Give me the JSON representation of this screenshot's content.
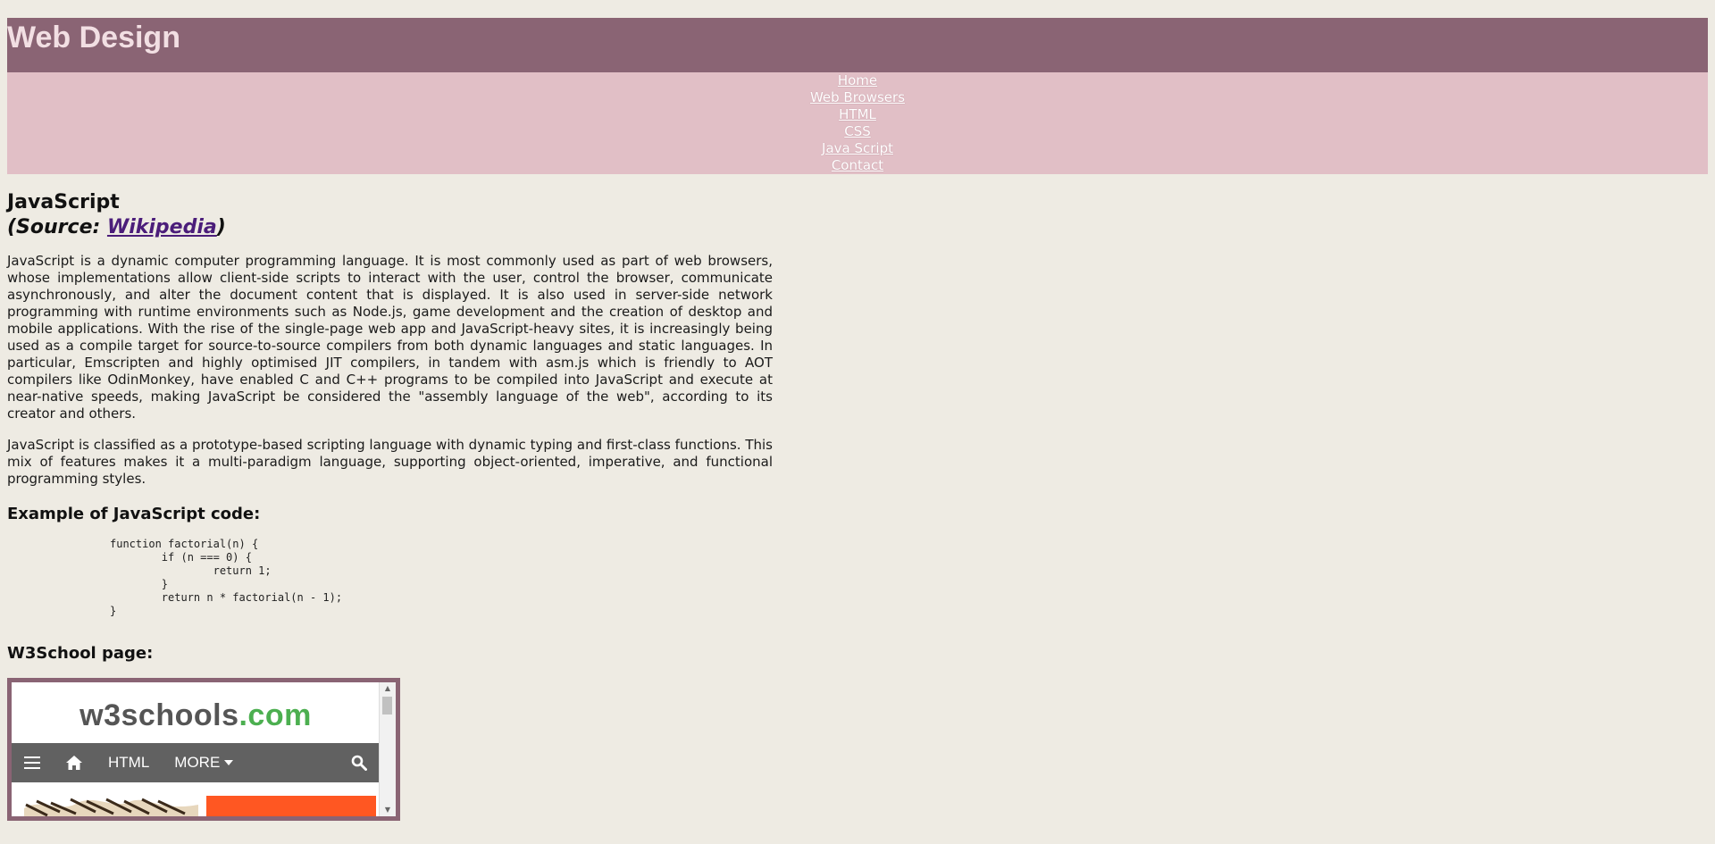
{
  "header": {
    "title": "Web Design"
  },
  "nav": {
    "items": [
      {
        "label": "Home"
      },
      {
        "label": "Web Browsers"
      },
      {
        "label": "HTML"
      },
      {
        "label": "CSS"
      },
      {
        "label": "Java Script"
      },
      {
        "label": "Contact"
      }
    ]
  },
  "main": {
    "title": "JavaScript",
    "source_prefix": "(Source: ",
    "source_link": "Wikipedia",
    "source_suffix": ")",
    "paragraph_1": "JavaScript is a dynamic computer programming language. It is most commonly used as part of web browsers, whose implementations allow client-side scripts to interact with the user, control the browser, communicate asynchronously, and alter the document content that is displayed. It is also used in server-side network programming with runtime environments such as Node.js, game development and the creation of desktop and mobile applications. With the rise of the single-page web app and JavaScript-heavy sites, it is increasingly being used as a compile target for source-to-source compilers from both dynamic languages and static languages. In particular, Emscripten and highly optimised JIT compilers, in tandem with asm.js which is friendly to AOT compilers like OdinMonkey, have enabled C and C++ programs to be compiled into JavaScript and execute at near-native speeds, making JavaScript be considered the \"assembly language of the web\", according to its creator and others.",
    "paragraph_2": "JavaScript is classified as a prototype-based scripting language with dynamic typing and first-class functions. This mix of features makes it a multi-paradigm language, supporting object-oriented, imperative, and functional programming styles.",
    "example_heading": "Example of JavaScript code:",
    "code": "function factorial(n) {\n\tif (n === 0) {\n\t\treturn 1;\n\t}\n\treturn n * factorial(n - 1);\n}",
    "w3_heading": "W3School page:"
  },
  "embed": {
    "logo_main": "w3schools",
    "logo_tld": ".com",
    "bar_html": "HTML",
    "bar_more": "MORE",
    "accent": "#4caf50",
    "bar_bg": "#616161",
    "banner_color": "#ff5722"
  },
  "colors": {
    "header_bg": "#8a6474",
    "nav_bg": "#e1bfc6",
    "page_bg": "#eeebe3"
  }
}
